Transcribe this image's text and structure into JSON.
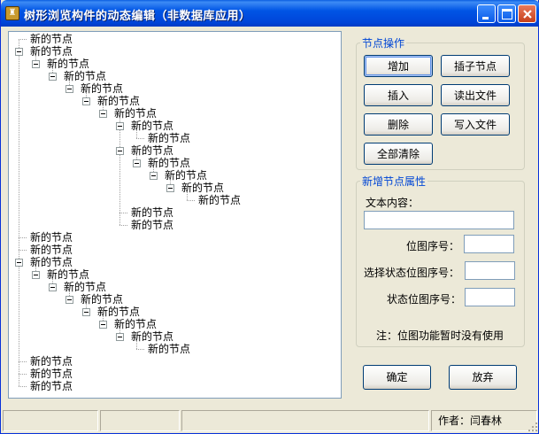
{
  "window": {
    "title": "树形浏览构件的动态编辑（非数据库应用）",
    "app_icon": "app-icon-glyph"
  },
  "tree": {
    "nodes": [
      {
        "label": "新的节点",
        "level": 0,
        "expander": false
      },
      {
        "label": "新的节点",
        "level": 0,
        "expander": true
      },
      {
        "label": "新的节点",
        "level": 1,
        "expander": true
      },
      {
        "label": "新的节点",
        "level": 2,
        "expander": true
      },
      {
        "label": "新的节点",
        "level": 3,
        "expander": true
      },
      {
        "label": "新的节点",
        "level": 4,
        "expander": true
      },
      {
        "label": "新的节点",
        "level": 5,
        "expander": true
      },
      {
        "label": "新的节点",
        "level": 6,
        "expander": true
      },
      {
        "label": "新的节点",
        "level": 7,
        "expander": false
      },
      {
        "label": "新的节点",
        "level": 6,
        "expander": true
      },
      {
        "label": "新的节点",
        "level": 7,
        "expander": true
      },
      {
        "label": "新的节点",
        "level": 8,
        "expander": true
      },
      {
        "label": "新的节点",
        "level": 9,
        "expander": true
      },
      {
        "label": "新的节点",
        "level": 10,
        "expander": false
      },
      {
        "label": "新的节点",
        "level": 6,
        "expander": false
      },
      {
        "label": "新的节点",
        "level": 6,
        "expander": false
      },
      {
        "label": "新的节点",
        "level": 0,
        "expander": false
      },
      {
        "label": "新的节点",
        "level": 0,
        "expander": false
      },
      {
        "label": "新的节点",
        "level": 0,
        "expander": true
      },
      {
        "label": "新的节点",
        "level": 1,
        "expander": true
      },
      {
        "label": "新的节点",
        "level": 2,
        "expander": true
      },
      {
        "label": "新的节点",
        "level": 3,
        "expander": true
      },
      {
        "label": "新的节点",
        "level": 4,
        "expander": true
      },
      {
        "label": "新的节点",
        "level": 5,
        "expander": true
      },
      {
        "label": "新的节点",
        "level": 6,
        "expander": true
      },
      {
        "label": "新的节点",
        "level": 7,
        "expander": false
      },
      {
        "label": "新的节点",
        "level": 0,
        "expander": false
      },
      {
        "label": "新的节点",
        "level": 0,
        "expander": false
      },
      {
        "label": "新的节点",
        "level": 0,
        "expander": false
      }
    ]
  },
  "node_ops": {
    "legend": "节点操作",
    "add": "增加",
    "insert_child": "插子节点",
    "insert": "插入",
    "read_file": "读出文件",
    "delete": "删除",
    "write_file": "写入文件",
    "clear_all": "全部清除"
  },
  "new_node": {
    "legend": "新增节点属性",
    "text_label": "文本内容：",
    "text_value": "",
    "image_index_label": "位图序号：",
    "image_index_value": "",
    "selected_index_label": "选择状态位图序号：",
    "selected_index_value": "",
    "state_index_label": "状态位图序号：",
    "state_index_value": "",
    "note": "注：位图功能暂时没有使用"
  },
  "actions": {
    "ok": "确定",
    "cancel": "放弃"
  },
  "status": {
    "author": "作者：闫春林"
  }
}
